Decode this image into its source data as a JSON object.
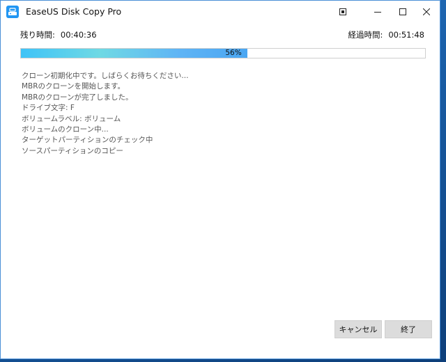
{
  "window": {
    "title": "EaseUS Disk Copy Pro"
  },
  "titlebar": {
    "icons": [
      "app-icon",
      "restore-window-icon",
      "minimize-icon",
      "maximize-icon",
      "close-icon"
    ]
  },
  "status": {
    "remaining_label": "残り時間:",
    "remaining_value": "00:40:36",
    "elapsed_label": "経過時間:",
    "elapsed_value": "00:51:48"
  },
  "progress": {
    "percent": 56,
    "text": "56%"
  },
  "log": {
    "lines": [
      "クローン初期化中です。しばらくお待ちください...",
      "MBRのクローンを開始します。",
      "MBRのクローンが完了しました。",
      "ドライブ文字: F",
      "ボリュームラベル: ボリューム",
      "ボリュームのクローン中...",
      "ターゲットパーティションのチェック中",
      "ソースパーティションのコピー"
    ]
  },
  "buttons": {
    "cancel_label": "キャンセル",
    "finish_label": "終了"
  },
  "colors": {
    "progress_accent": "#3fc3f7",
    "window_border": "#4a8fd6"
  }
}
